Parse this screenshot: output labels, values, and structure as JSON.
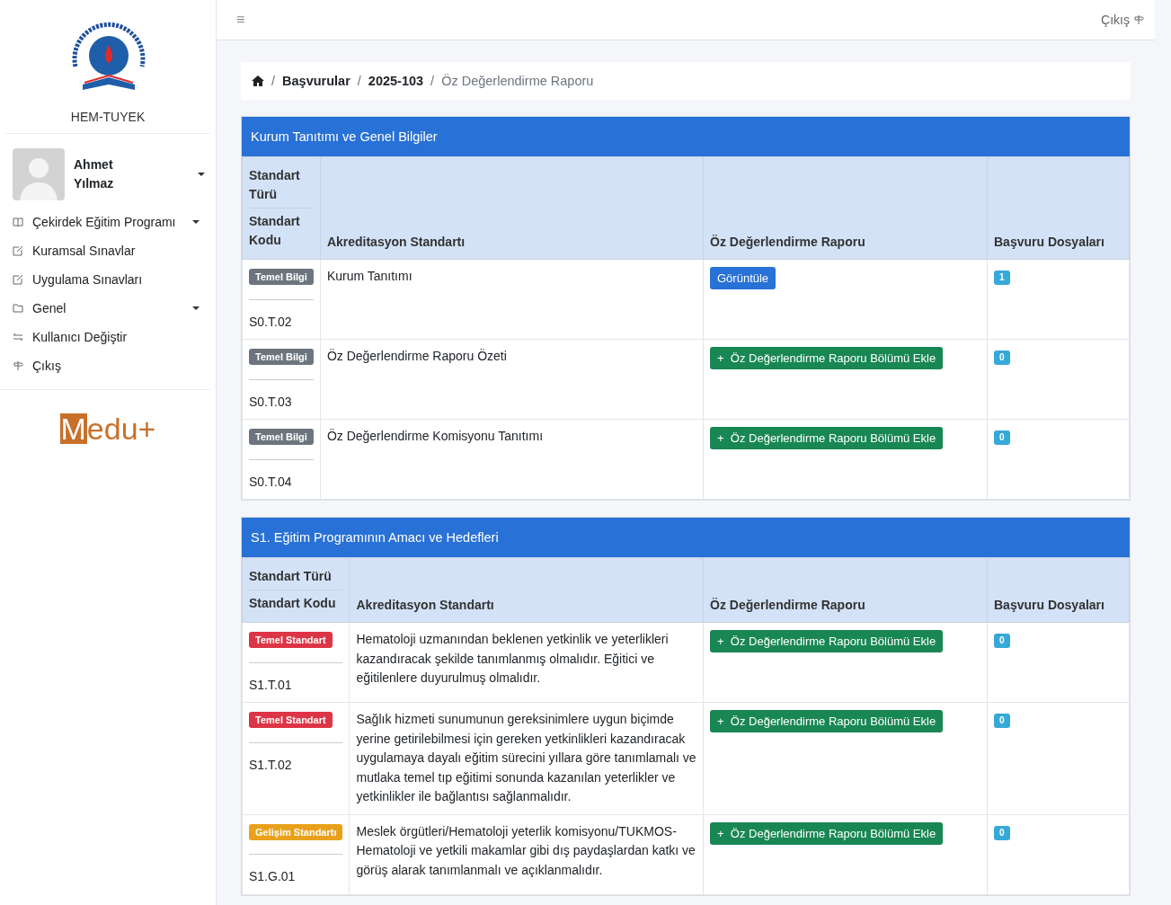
{
  "sidebar": {
    "org_name": "HEM-TUYEK",
    "user": {
      "first_name": "Ahmet",
      "last_name": "Yılmaz"
    },
    "items": [
      {
        "label": "Çekirdek Eğitim Programı",
        "kind": "book",
        "has_submenu": true
      },
      {
        "label": "Kuramsal Sınavlar",
        "kind": "edit",
        "has_submenu": false
      },
      {
        "label": "Uygulama Sınavları",
        "kind": "edit",
        "has_submenu": false
      },
      {
        "label": "Genel",
        "kind": "folder",
        "has_submenu": true
      },
      {
        "label": "Kullanıcı Değiştir",
        "kind": "swap",
        "has_submenu": false
      },
      {
        "label": "Çıkış",
        "kind": "signpost",
        "has_submenu": false
      }
    ],
    "brand": {
      "boxed": "M",
      "rest": "edu+"
    }
  },
  "topbar": {
    "menu_glyph": "≡",
    "logout": "Çıkış"
  },
  "breadcrumb": {
    "separator": "/",
    "items": [
      "Başvurular",
      "2025-103",
      "Öz Değerlendirme Raporu"
    ]
  },
  "sections": [
    {
      "title": "Kurum Tanıtımı ve Genel Bilgiler",
      "columns": {
        "type": "Standart Türü",
        "code": "Standart Kodu",
        "standard": "Akreditasyon Standartı",
        "report": "Öz Değerlendirme Raporu",
        "files": "Başvuru Dosyaları"
      },
      "rows": [
        {
          "badge": {
            "kind": "info",
            "label": "Temel Bilgi"
          },
          "code": "S0.T.02",
          "standard": "Kurum Tanıtımı",
          "action": {
            "kind": "view",
            "label": "Görüntüle"
          },
          "files": "1"
        },
        {
          "badge": {
            "kind": "info",
            "label": "Temel Bilgi"
          },
          "code": "S0.T.03",
          "standard": "Öz Değerlendirme Raporu Özeti",
          "action": {
            "kind": "add",
            "label": "+  Öz Değerlendirme Raporu Bölümü Ekle"
          },
          "files": "0"
        },
        {
          "badge": {
            "kind": "info",
            "label": "Temel Bilgi"
          },
          "code": "S0.T.04",
          "standard": "Öz Değerlendirme Komisyonu Tanıtımı",
          "action": {
            "kind": "add",
            "label": "+  Öz Değerlendirme Raporu Bölümü Ekle"
          },
          "files": "0"
        }
      ]
    },
    {
      "title": "S1. Eğitim Programının Amacı ve Hedefleri",
      "columns": {
        "type": "Standart Türü",
        "code": "Standart Kodu",
        "standard": "Akreditasyon Standartı",
        "report": "Öz Değerlendirme Raporu",
        "files": "Başvuru Dosyaları"
      },
      "rows": [
        {
          "badge": {
            "kind": "core",
            "label": "Temel Standart"
          },
          "code": "S1.T.01",
          "standard": "Hematoloji uzmanından beklenen yetkinlik ve yeterlikleri kazandıracak şekilde tanımlanmış olmalıdır. Eğitici ve eğitilenlere duyurulmuş olmalıdır.",
          "action": {
            "kind": "add",
            "label": "+  Öz Değerlendirme Raporu Bölümü Ekle"
          },
          "files": "0"
        },
        {
          "badge": {
            "kind": "core",
            "label": "Temel Standart"
          },
          "code": "S1.T.02",
          "standard": "Sağlık hizmeti sunumunun gereksinimlere uygun biçimde yerine getirilebilmesi için gereken yetkinlikleri kazandıracak uygulamaya dayalı eğitim sürecini yıllara göre tanımlamalı ve mutlaka temel tıp eğitimi sonunda kazanılan yeterlikler ve yetkinlikler ile bağlantısı sağlanmalıdır.",
          "action": {
            "kind": "add",
            "label": "+  Öz Değerlendirme Raporu Bölümü Ekle"
          },
          "files": "0"
        },
        {
          "badge": {
            "kind": "development",
            "label": "Gelişim Standartı"
          },
          "code": "S1.G.01",
          "standard": "Meslek örgütleri/Hematoloji yeterlik komisyonu/TUKMOS-Hematoloji ve yetkili makamlar gibi dış paydaşlardan katkı ve görüş alarak tanımlanmalı ve açıklanmalıdır.",
          "action": {
            "kind": "add",
            "label": "+  Öz Değerlendirme Raporu Bölümü Ekle"
          },
          "files": "0"
        }
      ]
    }
  ]
}
